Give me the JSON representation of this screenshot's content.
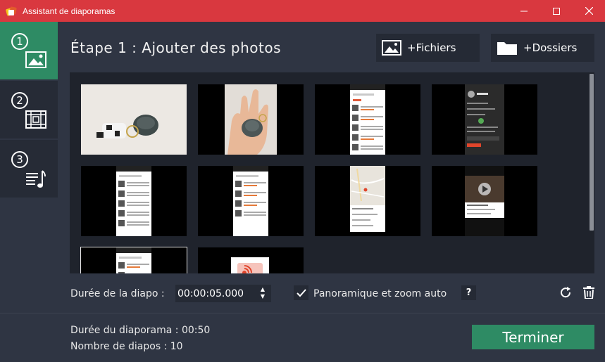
{
  "window": {
    "title": "Assistant de diaporamas"
  },
  "sidebar": {
    "steps": [
      {
        "number": "1",
        "icon": "image-icon",
        "active": true
      },
      {
        "number": "2",
        "icon": "film-transition-icon",
        "active": false
      },
      {
        "number": "3",
        "icon": "music-list-icon",
        "active": false
      }
    ]
  },
  "header": {
    "title": "Étape 1 : Ajouter des photos",
    "add_files_label": "+Fichiers",
    "add_folders_label": "+Dossiers"
  },
  "gallery": {
    "thumbnails": [
      {
        "kind": "photo-keychain-table"
      },
      {
        "kind": "photo-keychain-hand"
      },
      {
        "kind": "app-screenshot-feed"
      },
      {
        "kind": "app-screenshot-profile"
      },
      {
        "kind": "app-screenshot-list"
      },
      {
        "kind": "app-screenshot-feed"
      },
      {
        "kind": "app-screenshot-map"
      },
      {
        "kind": "app-screenshot-video"
      },
      {
        "kind": "app-screenshot-list",
        "selected": true
      },
      {
        "kind": "app-screenshot-share"
      }
    ]
  },
  "controls": {
    "duration_label": "Durée de la diapo :",
    "duration_value": "00:00:05.000",
    "pan_zoom_label": "Panoramique et zoom auto",
    "pan_zoom_checked": true,
    "help_label": "?"
  },
  "summary": {
    "total_duration": "Durée du diaporama : 00:50",
    "slide_count": "Nombre de diapos : 10"
  },
  "footer": {
    "finish_label": "Terminer"
  },
  "colors": {
    "accent": "#2e8b64",
    "titlebar": "#d9383f",
    "background": "#2f3543"
  }
}
